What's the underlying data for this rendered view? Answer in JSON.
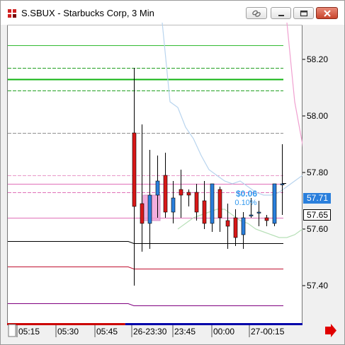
{
  "window": {
    "title": "S.SBUX - Starbucks Corp, 3 Min",
    "icons": {
      "app": "chart-app-icon",
      "link": "link-icon",
      "minimize": "minimize-icon",
      "maximize": "maximize-icon",
      "close": "close-icon",
      "scroll": "scroll-right-arrow-icon"
    }
  },
  "chart_data": {
    "type": "candlestick",
    "symbol": "S.SBUX",
    "interval": "3 Min",
    "ylim": [
      57.31,
      58.33
    ],
    "y_ticks": [
      "58.20",
      "58.00",
      "57.80",
      "57.60",
      "57.40"
    ],
    "x_ticks": [
      "05:15",
      "05:30",
      "05:45",
      "26-23:30",
      "23:45",
      "00:00",
      "27-00:15"
    ],
    "price_labels": [
      {
        "text": "57.71",
        "value": 57.71,
        "style": "highlight"
      },
      {
        "text": "57.65",
        "value": 57.65,
        "style": "box"
      }
    ],
    "change_annotation": {
      "amount": "$0.06",
      "percent": "0.10%"
    },
    "candles": [
      {
        "o": 57.94,
        "h": 58.17,
        "l": 57.4,
        "c": 57.68
      },
      {
        "o": 57.69,
        "h": 57.97,
        "l": 57.52,
        "c": 57.62
      },
      {
        "o": 57.62,
        "h": 57.88,
        "l": 57.53,
        "c": 57.72
      },
      {
        "o": 57.72,
        "h": 57.86,
        "l": 57.64,
        "c": 57.77
      },
      {
        "o": 57.79,
        "h": 57.87,
        "l": 57.64,
        "c": 57.66
      },
      {
        "o": 57.66,
        "h": 57.77,
        "l": 57.62,
        "c": 57.71
      },
      {
        "o": 57.74,
        "h": 57.81,
        "l": 57.64,
        "c": 57.72
      },
      {
        "o": 57.73,
        "h": 57.74,
        "l": 57.68,
        "c": 57.72
      },
      {
        "o": 57.73,
        "h": 57.76,
        "l": 57.63,
        "c": 57.66
      },
      {
        "o": 57.7,
        "h": 57.77,
        "l": 57.6,
        "c": 57.62
      },
      {
        "o": 57.62,
        "h": 57.76,
        "l": 57.59,
        "c": 57.76
      },
      {
        "o": 57.74,
        "h": 57.75,
        "l": 57.59,
        "c": 57.64
      },
      {
        "o": 57.63,
        "h": 57.69,
        "l": 57.53,
        "c": 57.61
      },
      {
        "o": 57.64,
        "h": 57.67,
        "l": 57.54,
        "c": 57.57
      },
      {
        "o": 57.58,
        "h": 57.66,
        "l": 57.53,
        "c": 57.64
      },
      {
        "o": 57.65,
        "h": 57.71,
        "l": 57.64,
        "c": 57.65
      },
      {
        "o": 57.66,
        "h": 57.7,
        "l": 57.61,
        "c": 57.66
      },
      {
        "o": 57.64,
        "h": 57.65,
        "l": 57.61,
        "c": 57.63
      },
      {
        "o": 57.62,
        "h": 57.74,
        "l": 57.61,
        "c": 57.76
      },
      {
        "o": 57.76,
        "h": 57.9,
        "l": 57.65,
        "c": 57.76
      }
    ],
    "levels": [
      {
        "value": 58.25,
        "color": "#33bb33",
        "style": "solid",
        "width": 1
      },
      {
        "value": 58.17,
        "color": "#22a022",
        "style": "dashed",
        "width": 1
      },
      {
        "value": 58.13,
        "color": "#11b311",
        "style": "solid",
        "width": 2
      },
      {
        "value": 58.09,
        "color": "#22a022",
        "style": "dashed",
        "width": 1
      },
      {
        "value": 57.94,
        "color": "#909090",
        "style": "dashed",
        "width": 1
      },
      {
        "value": 57.79,
        "color": "#e898c8",
        "style": "dashed",
        "width": 1
      },
      {
        "value": 57.76,
        "color": "#e070b8",
        "style": "solid",
        "width": 1
      },
      {
        "value": 57.73,
        "color": "#e070b8",
        "style": "dashed",
        "width": 1
      },
      {
        "value": 57.64,
        "color": "#e070b8",
        "style": "solid",
        "width": 1
      },
      {
        "value": 57.55,
        "color": "#000000",
        "style": "solid",
        "width": 1
      },
      {
        "value": 57.46,
        "color": "#c01030",
        "style": "solid",
        "width": 1
      },
      {
        "value": 57.33,
        "color": "#800080",
        "style": "solid",
        "width": 1
      }
    ],
    "bands": {
      "upper": {
        "color": "#b8d4ee",
        "points": [
          [
            0,
            58.33
          ],
          [
            1,
            58.05
          ],
          [
            2,
            58.03
          ],
          [
            3,
            57.96
          ],
          [
            4,
            57.92
          ],
          [
            5,
            57.86
          ],
          [
            6,
            57.81
          ],
          [
            7,
            57.79
          ],
          [
            8,
            57.77
          ],
          [
            9,
            57.76
          ],
          [
            10,
            57.77
          ],
          [
            11,
            57.75
          ],
          [
            12,
            57.73
          ],
          [
            13,
            57.72
          ],
          [
            14,
            57.72
          ],
          [
            15,
            57.73
          ],
          [
            16,
            57.75
          ],
          [
            17,
            57.77
          ],
          [
            18,
            57.79
          ],
          [
            19,
            57.8
          ]
        ]
      },
      "lower": {
        "color": "#b8e0b8",
        "points": [
          [
            2,
            57.6
          ],
          [
            3,
            57.62
          ],
          [
            4,
            57.64
          ],
          [
            5,
            57.65
          ],
          [
            6,
            57.66
          ],
          [
            7,
            57.67
          ],
          [
            8,
            57.67
          ],
          [
            9,
            57.65
          ],
          [
            10,
            57.63
          ],
          [
            11,
            57.62
          ],
          [
            12,
            57.6
          ],
          [
            13,
            57.59
          ],
          [
            14,
            57.58
          ],
          [
            15,
            57.57
          ],
          [
            16,
            57.57
          ],
          [
            17,
            57.58
          ],
          [
            18,
            57.6
          ],
          [
            19,
            57.63
          ]
        ]
      },
      "pink": {
        "color": "#f0a0d0",
        "points": [
          [
            16,
            58.33
          ],
          [
            17,
            58.05
          ],
          [
            18,
            57.9
          ],
          [
            19,
            57.7
          ]
        ]
      }
    },
    "time_scale_bar": [
      {
        "from": 0,
        "to": 0.4,
        "color": "#cc0000"
      },
      {
        "from": 0.4,
        "to": 1,
        "color": "#0000aa"
      }
    ]
  }
}
